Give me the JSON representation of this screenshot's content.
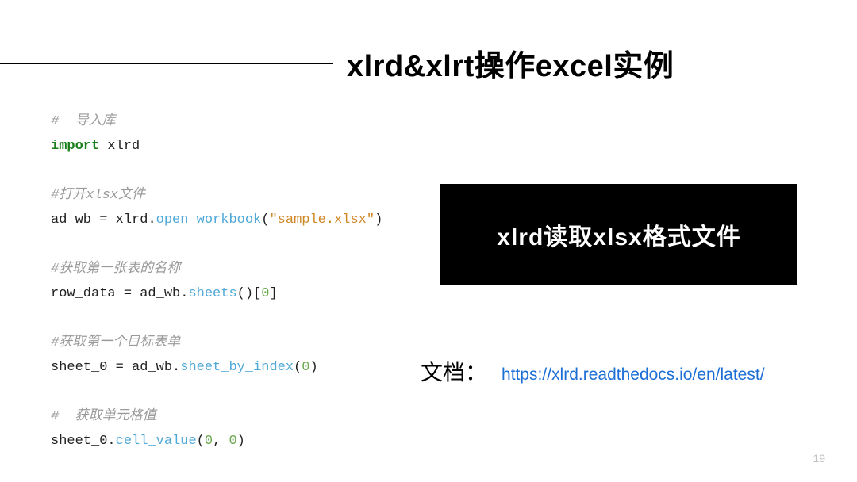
{
  "title": "xlrd&xlrt操作excel实例",
  "code": {
    "l1": "#  导入库",
    "l2a": "import",
    "l2b": " xlrd",
    "l3": "#打开xlsx文件",
    "l4a": "ad_wb ",
    "l4eq": "=",
    "l4b": " xlrd",
    "l4dot1": ".",
    "l4fn": "open_workbook",
    "l4p1": "(",
    "l4str": "\"sample.xlsx\"",
    "l4p2": ")",
    "l5": "#获取第一张表的名称",
    "l6a": "row_data ",
    "l6eq": "=",
    "l6b": " ad_wb",
    "l6dot": ".",
    "l6fn": "sheets",
    "l6p": "()[",
    "l6n": "0",
    "l6p2": "]",
    "l7": "#获取第一个目标表单",
    "l8a": "sheet_0 ",
    "l8eq": "=",
    "l8b": " ad_wb",
    "l8dot": ".",
    "l8fn": "sheet_by_index",
    "l8p1": "(",
    "l8n": "0",
    "l8p2": ")",
    "l9": "#  获取单元格值",
    "l10a": "sheet_0",
    "l10dot": ".",
    "l10fn": "cell_value",
    "l10p1": "(",
    "l10n1": "0",
    "l10c": ", ",
    "l10n2": "0",
    "l10p2": ")"
  },
  "banner": "xlrd读取xlsx格式文件",
  "doc_label": "文档：",
  "doc_url": "https://xlrd.readthedocs.io/en/latest/",
  "page_number": "19"
}
